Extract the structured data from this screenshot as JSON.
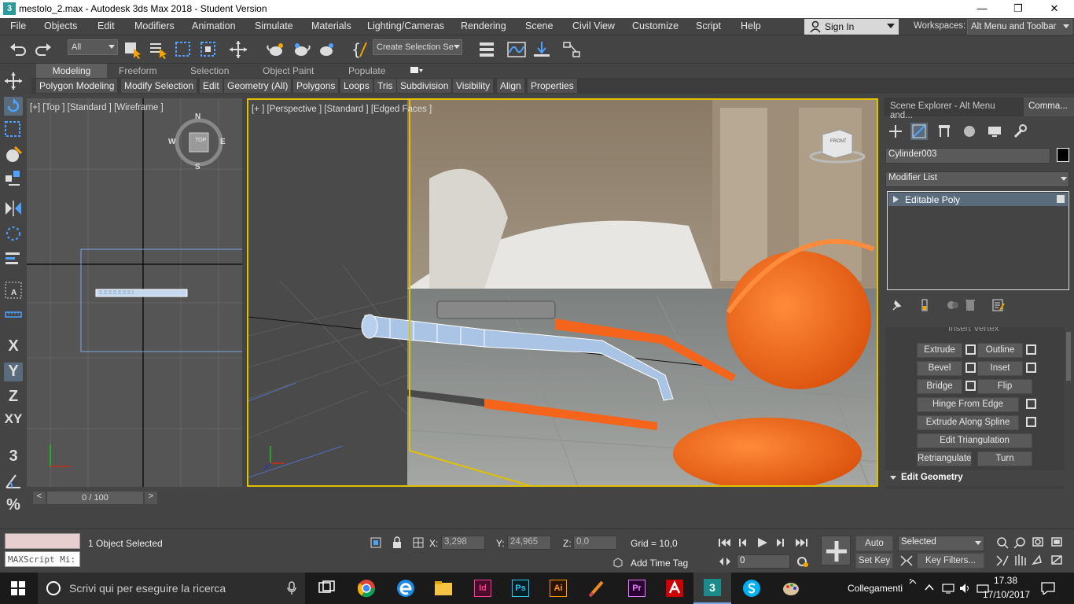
{
  "window": {
    "title": "mestolo_2.max - Autodesk 3ds Max 2018 - Student Version",
    "app_icon": "3"
  },
  "menu": [
    "File",
    "Objects",
    "Edit",
    "Modifiers",
    "Animation",
    "Simulate",
    "Materials",
    "Lighting/Cameras",
    "Rendering",
    "Scene",
    "Civil View",
    "Customize",
    "Script",
    "Help"
  ],
  "signin": {
    "label": "Sign In"
  },
  "workspaces": {
    "label": "Workspaces:",
    "value": "Alt Menu and Toolbar"
  },
  "toolbar": {
    "selection_filter": "All",
    "selection_set": "Create Selection Se"
  },
  "ribbon": {
    "tabs": [
      "Modeling",
      "Freeform",
      "Selection",
      "Object Paint",
      "Populate"
    ],
    "buttons": [
      "Polygon Modeling",
      "Modify Selection",
      "Edit",
      "Geometry (All)",
      "Polygons",
      "Loops",
      "Tris",
      "Subdivision",
      "Visibility",
      "Align",
      "Properties"
    ]
  },
  "left_tools": {
    "x": "X",
    "y": "Y",
    "z": "Z",
    "xy": "XY",
    "three": "3",
    "percent": "%"
  },
  "viewports": {
    "top_label": "[+] [Top ] [Standard ] [Wireframe ]",
    "persp_label": "[+ ] [Perspective ] [Standard ] [Edged Faces ]",
    "viewcube": {
      "top_face": "TOP",
      "n": "N",
      "s": "S",
      "e": "E",
      "w": "W",
      "persp_face": "FRONT"
    }
  },
  "command_panel": {
    "scene_explorer_tab": "Scene Explorer - Alt Menu and...",
    "command_tab": "Comma...",
    "object_name": "Cylinder003",
    "modifier_list": "Modifier List",
    "stack": [
      "Editable Poly"
    ],
    "cut_text": "Insert Vertex",
    "buttons": [
      {
        "label": "Extrude",
        "settings": true
      },
      {
        "label": "Outline",
        "settings": true
      },
      {
        "label": "Bevel",
        "settings": true
      },
      {
        "label": "Inset",
        "settings": true
      },
      {
        "label": "Bridge",
        "settings": true
      },
      {
        "label": "Flip",
        "settings": false
      },
      {
        "label": "Hinge From Edge",
        "settings": true
      },
      {
        "label": "Extrude Along Spline",
        "settings": true
      },
      {
        "label": "Edit Triangulation",
        "settings": false
      },
      {
        "label": "Retriangulate",
        "settings": false
      },
      {
        "label": "Turn",
        "settings": false
      }
    ],
    "rollout": "Edit Geometry"
  },
  "timeline": {
    "frame": "0 / 100",
    "prev": "<",
    "next": ">"
  },
  "status": {
    "maxscript_placeholder": "MAXScript Mi:",
    "selected": "1 Object Selected",
    "x_label": "X:",
    "x": "3,298",
    "y_label": "Y:",
    "y": "24,965",
    "z_label": "Z:",
    "z": "0,0",
    "grid": "Grid = 10,0",
    "add_time_tag": "Add Time Tag",
    "auto_key": "Auto Key",
    "set_key": "Set Key",
    "key_mode": "Selected",
    "key_filters": "Key Filters...",
    "frame_field": "0"
  },
  "taskbar": {
    "search_placeholder": "Scrivi qui per eseguire la ricerca",
    "links": "Collegamenti",
    "time": "17.38",
    "date": "17/10/2017",
    "apps": [
      "task-view",
      "chrome",
      "edge",
      "explorer",
      "indesign",
      "photoshop",
      "illustrator",
      "paint",
      "premiere",
      "acrobat",
      "3dsmax",
      "skype",
      "palette"
    ],
    "app_labels": {
      "indesign": "Id",
      "photoshop": "Ps",
      "illustrator": "Ai",
      "premiere": "Pr",
      "max": "3"
    }
  },
  "colors": {
    "accent_yellow": "#e0c000",
    "object_blue": "#a9c4e4",
    "orange": "#ff6a1a",
    "bg": "#444444"
  }
}
